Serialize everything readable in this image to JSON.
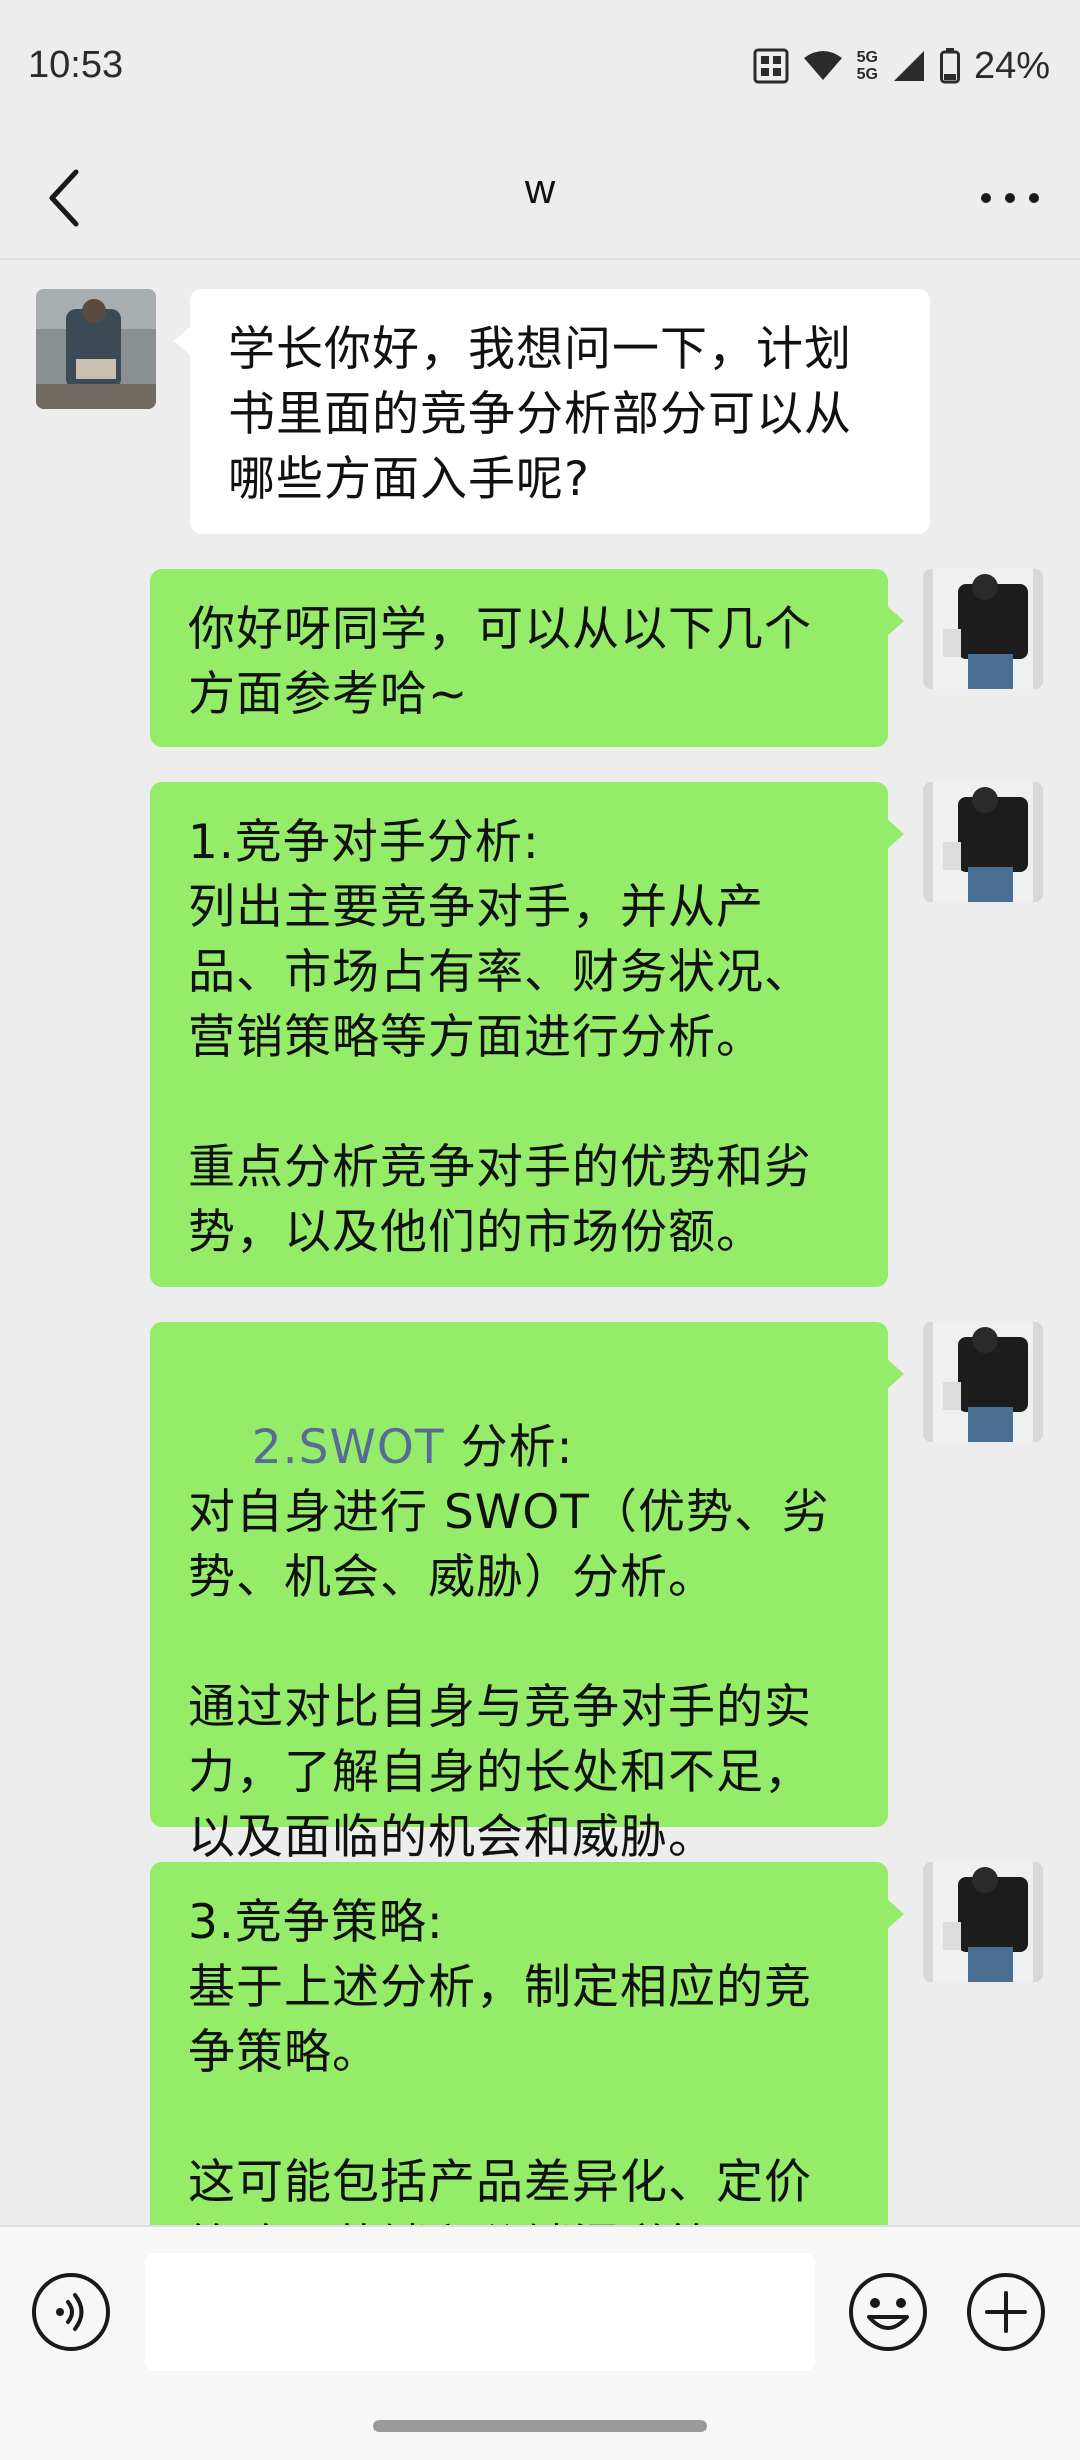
{
  "status_bar": {
    "time": "10:53",
    "network": "5G",
    "network2": "5G",
    "battery": "24%"
  },
  "header": {
    "title": "w",
    "back_icon": "chevron-left-icon",
    "more_icon": "more-horizontal-icon"
  },
  "messages": [
    {
      "side": "left",
      "text": "学长你好，我想问一下，计划书里面的竞争分析部分可以从哪些方面入手呢?"
    },
    {
      "side": "right",
      "text": "你好呀同学，可以从以下几个方面参考哈~"
    },
    {
      "side": "right",
      "text": "1.竞争对手分析:\n列出主要竞争对手，并从产品、市场占有率、财务状况、营销策略等方面进行分析。\n\n重点分析竞争对手的优势和劣势，以及他们的市场份额。"
    },
    {
      "side": "right",
      "heading_link": "2.SWOT",
      "heading_rest": " 分析:",
      "text": "对自身进行 SWOT（优势、劣势、机会、威胁）分析。\n\n通过对比自身与竞争对手的实力，了解自身的长处和不足，以及面临的机会和威胁。"
    },
    {
      "side": "right",
      "text": "3.竞争策略:\n基于上述分析，制定相应的竞争策略。\n\n这可能包括产品差异化、定价策略、营销和分销渠道等"
    }
  ],
  "input_bar": {
    "voice_icon": "voice-icon",
    "input_value": "",
    "emoji_icon": "emoji-icon",
    "plus_icon": "plus-icon"
  },
  "colors": {
    "background": "#ededed",
    "bubble_self": "#95ec69",
    "bubble_other": "#ffffff",
    "link": "#576b95"
  }
}
